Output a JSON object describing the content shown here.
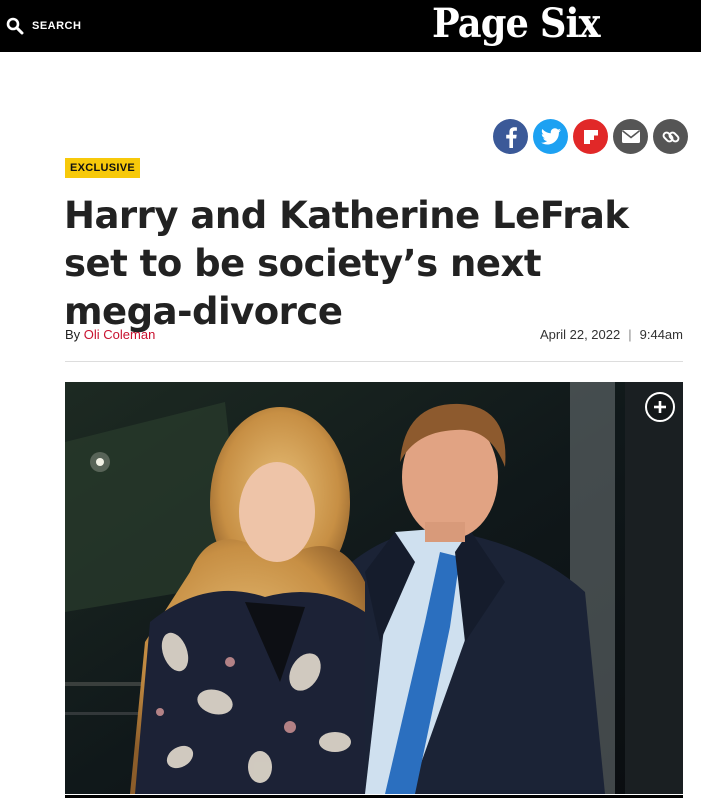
{
  "header": {
    "search_label": "SEARCH",
    "logo_text": "Page Six",
    "search_icon": "search-icon"
  },
  "share": {
    "icons": [
      "facebook-icon",
      "twitter-icon",
      "flipboard-icon",
      "email-icon",
      "link-icon"
    ],
    "colors": {
      "facebook": "#3b5998",
      "twitter": "#1da1f2",
      "flipboard": "#e12828",
      "email": "#555555",
      "link": "#555555"
    }
  },
  "article": {
    "badge": "EXCLUSIVE",
    "headline": "Harry and Katherine LeFrak set to be society’s next mega-divorce",
    "by_prefix": "By",
    "author": "Oli Coleman",
    "date": "April 22, 2022",
    "separator": "|",
    "time": "9:44am"
  },
  "photo": {
    "expand_icon": "expand-plus-icon"
  },
  "colors": {
    "badge": "#f7c90a",
    "author_link": "#c8102e",
    "topbar": "#000000"
  }
}
